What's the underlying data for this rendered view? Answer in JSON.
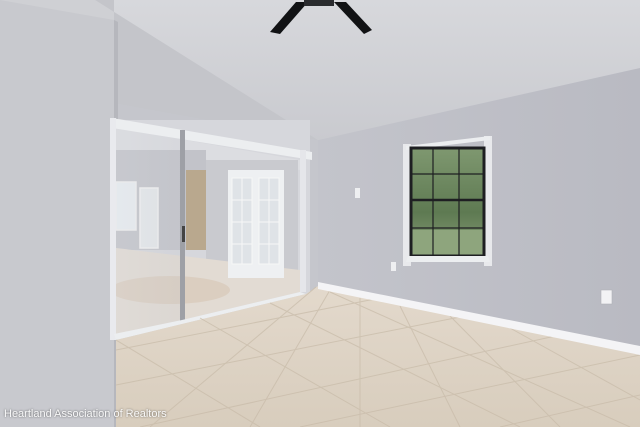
{
  "photo": {
    "watermark": "Heartland Association of Realtors"
  }
}
